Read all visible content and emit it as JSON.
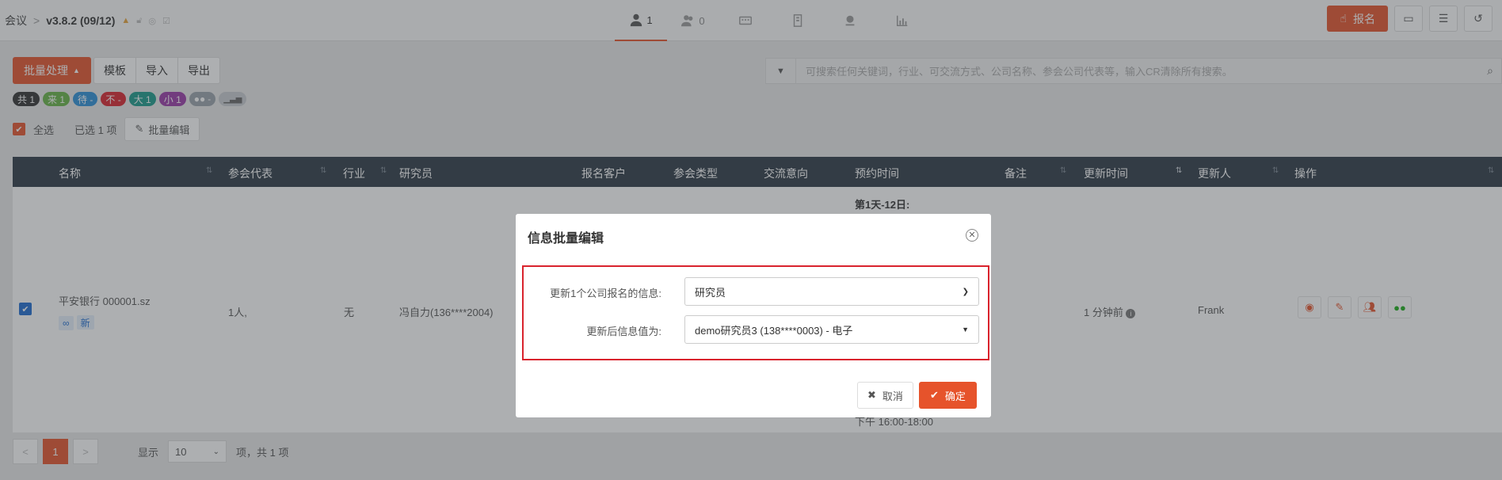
{
  "header": {
    "crumb_root": "会议",
    "version": "v3.8.2 (09/12)",
    "tabs": [
      {
        "icon": "person-icon",
        "count": "1"
      },
      {
        "icon": "group-icon",
        "count": "0"
      },
      {
        "icon": "keyboard-icon",
        "count": ""
      },
      {
        "icon": "building-icon",
        "count": ""
      },
      {
        "icon": "location-icon",
        "count": ""
      },
      {
        "icon": "chart-icon",
        "count": ""
      }
    ],
    "signup_label": "报名"
  },
  "toolbar": {
    "batch_label": "批量处理",
    "template_label": "模板",
    "import_label": "导入",
    "export_label": "导出",
    "search_placeholder": "可搜索任何关键词，行业、可交流方式、公司名称、参会公司代表等，输入CR清除所有搜索。"
  },
  "badges": [
    {
      "label": "共 1",
      "color": "#333333"
    },
    {
      "label": "来 1",
      "color": "#67b346"
    },
    {
      "label": "待 -",
      "color": "#2b8fd8"
    },
    {
      "label": "不 -",
      "color": "#d9232d"
    },
    {
      "label": "大 1",
      "color": "#1a9a8a"
    },
    {
      "label": "小 1",
      "color": "#9a3aa8"
    },
    {
      "label": "-",
      "color": "#9aa3ab"
    },
    {
      "label": "",
      "color": "#c8ccd0"
    }
  ],
  "selection": {
    "select_all_label": "全选",
    "selected_text": "已选 1 项",
    "batch_edit_label": "批量编辑"
  },
  "table": {
    "columns": [
      "名称",
      "参会代表",
      "行业",
      "研究员",
      "报名客户",
      "参会类型",
      "交流意向",
      "预约时间",
      "备注",
      "更新时间",
      "更新人",
      "操作"
    ],
    "row": {
      "name": "平安银行 000001.sz",
      "tag_new": "新",
      "representative": "1人,",
      "industry": "无",
      "researcher": "冯自力(136****2004)",
      "time_header": "第1天-12日:",
      "time_bottom": "下午 16:00-18:00",
      "updated": "1 分钟前",
      "updater": "Frank"
    }
  },
  "pagination": {
    "prev": "<",
    "current": "1",
    "next": ">",
    "show_label": "显示",
    "page_size": "10",
    "summary": "项，共 1 项"
  },
  "modal": {
    "title": "信息批量编辑",
    "field1_label": "更新1个公司报名的信息:",
    "field1_value": "研究员",
    "field2_label": "更新后信息值为:",
    "field2_value": "demo研究员3 (138****0003) - 电子",
    "cancel_label": "取消",
    "ok_label": "确定",
    "accent_color": "#e6532b"
  }
}
